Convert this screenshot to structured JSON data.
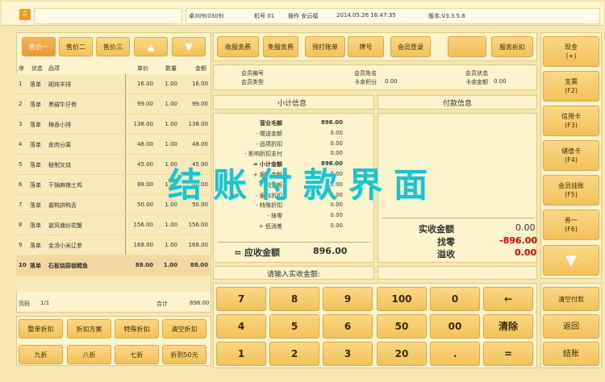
{
  "header": {
    "table": "桌309(0309)",
    "machine": "机号 01",
    "operator": "操作 安云福",
    "datetime": "2014.05.26 16:47:35",
    "version": "版本:V3.3.5.8"
  },
  "price_tabs": [
    "售价一",
    "售价二",
    "售价三"
  ],
  "arrows": {
    "up": "▲",
    "down": "▼"
  },
  "order_columns": [
    "序",
    "状态",
    "品项",
    "单价",
    "数量",
    "金额"
  ],
  "order_rows": [
    {
      "no": "1",
      "status": "落单",
      "item": "砌炖羊排",
      "price": "16.00",
      "qty": "1.00",
      "amount": "16.00"
    },
    {
      "no": "2",
      "status": "落单",
      "item": "黑椒牛仔骨",
      "price": "99.00",
      "qty": "1.00",
      "amount": "99.00"
    },
    {
      "no": "3",
      "status": "落单",
      "item": "梅香小排",
      "price": "138.00",
      "qty": "1.00",
      "amount": "138.00"
    },
    {
      "no": "4",
      "status": "落单",
      "item": "皮肉分离",
      "price": "48.00",
      "qty": "1.00",
      "amount": "48.00"
    },
    {
      "no": "5",
      "status": "落单",
      "item": "秘制叉烧",
      "price": "45.00",
      "qty": "1.00",
      "amount": "45.00"
    },
    {
      "no": "6",
      "status": "落单",
      "item": "干锅麻辣土鸡",
      "price": "88.00",
      "qty": "1.00",
      "amount": "88.00"
    },
    {
      "no": "7",
      "status": "落单",
      "item": "酱鸭拼鸭舌",
      "price": "50.00",
      "qty": "1.00",
      "amount": "50.00"
    },
    {
      "no": "8",
      "status": "落单",
      "item": "避风塘炒花蟹",
      "price": "156.00",
      "qty": "1.00",
      "amount": "156.00"
    },
    {
      "no": "9",
      "status": "落单",
      "item": "金汤小米辽参",
      "price": "168.00",
      "qty": "1.00",
      "amount": "168.00"
    },
    {
      "no": "10",
      "status": "落单",
      "item": "石板烧蒜银鳕鱼",
      "price": "88.00",
      "qty": "1.00",
      "amount": "88.00"
    }
  ],
  "footer": {
    "page_label": "页码",
    "page": "1/1",
    "total_label": "合计",
    "total": "896.00"
  },
  "discount_buttons": [
    "整单折扣",
    "折扣方案",
    "特殊折扣",
    "清空折扣",
    "九折",
    "八折",
    "七折",
    "折到50元"
  ],
  "function_buttons": [
    "收服务费",
    "免服务费",
    "预打账单",
    "牌号",
    "会员登录",
    "",
    "服务折扣"
  ],
  "member": {
    "member_no_label": "会员编号",
    "member_type_label": "会员类型",
    "member_name_label": "会员姓名",
    "points_label": "卡余积分",
    "points": "0.00",
    "status_label": "会员状态",
    "balance_label": "卡余金额",
    "balance": "0.00"
  },
  "subtotal": {
    "title": "小计信息",
    "lines": [
      {
        "label": "营业毛额",
        "value": "896.00"
      },
      {
        "label": "- 赠送金额",
        "value": "0.00"
      },
      {
        "label": "- 品项折扣",
        "value": "0.00"
      },
      {
        "label": "- 影响折扣支付",
        "value": "0.00"
      },
      {
        "label": "= 小计金额",
        "value": "896.00"
      },
      {
        "label": "+ 服务金额",
        "value": "0.00"
      },
      {
        "label": "+ 税金额",
        "value": "0.00"
      },
      {
        "label": "- 服务折扣",
        "value": "0.00"
      },
      {
        "label": "- 特殊折扣",
        "value": "0.00"
      },
      {
        "label": "- 抹零",
        "value": "0.00"
      },
      {
        "label": "+ 低消差",
        "value": "0.00"
      }
    ],
    "receivable_label": "= 应收金额",
    "receivable": "896.00"
  },
  "payment": {
    "title": "付款信息",
    "received_label": "实收金额",
    "received": "0.00",
    "change_label": "找零",
    "change": "-896.00",
    "overflow_label": "溢收",
    "overflow": "0.00"
  },
  "input": {
    "prompt": "请输入实收金额:"
  },
  "keypad": [
    [
      "7",
      "8",
      "9",
      "100",
      "0",
      "←"
    ],
    [
      "4",
      "5",
      "6",
      "50",
      "00",
      "清除"
    ],
    [
      "1",
      "2",
      "3",
      "20",
      ".",
      "="
    ]
  ],
  "pay_methods": [
    {
      "label": "现金",
      "key": "(+)"
    },
    {
      "label": "支票",
      "key": "(F2)"
    },
    {
      "label": "信用卡",
      "key": "(F3)"
    },
    {
      "label": "储值卡",
      "key": "(F4)"
    },
    {
      "label": "会员挂账",
      "key": "(F5)"
    },
    {
      "label": "券一",
      "key": "(F6)"
    }
  ],
  "right_bottom": [
    "清空付款",
    "返回",
    "结账"
  ],
  "watermark": "结账付款界面",
  "colors": {
    "accent": "#f3c15a",
    "change_red": "#e00000",
    "watermark": "#21c1c8"
  }
}
